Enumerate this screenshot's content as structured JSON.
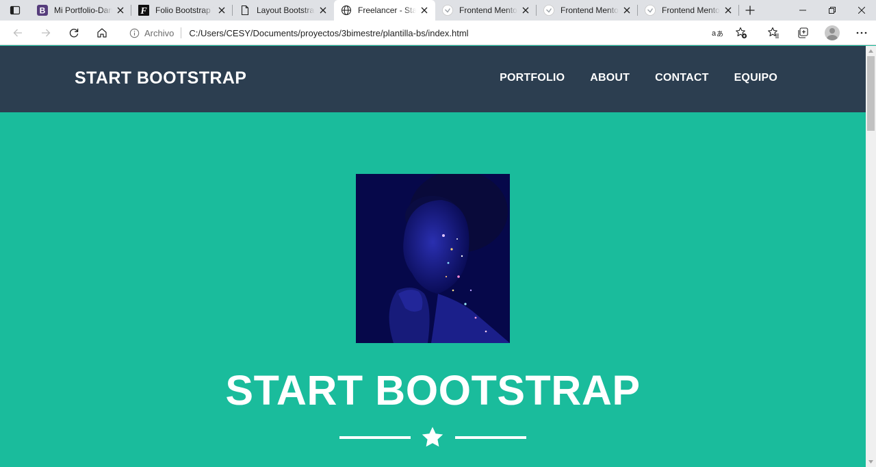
{
  "browser": {
    "tabs": [
      {
        "title": "Mi Portfolio-Daniel",
        "favicon": "bootstrap-b-icon",
        "active": false
      },
      {
        "title": "Folio Bootstrap Template",
        "favicon": "folio-f-icon",
        "active": false
      },
      {
        "title": "Layout Bootstrap",
        "favicon": "page-icon",
        "active": false
      },
      {
        "title": "Freelancer - Start Bootstrap",
        "favicon": "globe-icon",
        "active": true
      },
      {
        "title": "Frontend Mentor",
        "favicon": "frontend-mentor-icon",
        "active": false
      },
      {
        "title": "Frontend Mentor",
        "favicon": "frontend-mentor-icon",
        "active": false
      },
      {
        "title": "Frontend Mentor",
        "favicon": "frontend-mentor-icon",
        "active": false
      }
    ],
    "address": {
      "site_label": "Archivo",
      "url": "C:/Users/CESY/Documents/proyectos/3bimestre/plantilla-bs/index.html"
    }
  },
  "site": {
    "brand": "START BOOTSTRAP",
    "menu": [
      {
        "label": "PORTFOLIO"
      },
      {
        "label": "ABOUT"
      },
      {
        "label": "CONTACT"
      },
      {
        "label": "EQUIPO"
      }
    ],
    "hero": {
      "title": "START BOOTSTRAP"
    }
  },
  "colors": {
    "navbar": "#2c3e50",
    "hero_bg": "#1abc9c",
    "text": "#ffffff"
  }
}
